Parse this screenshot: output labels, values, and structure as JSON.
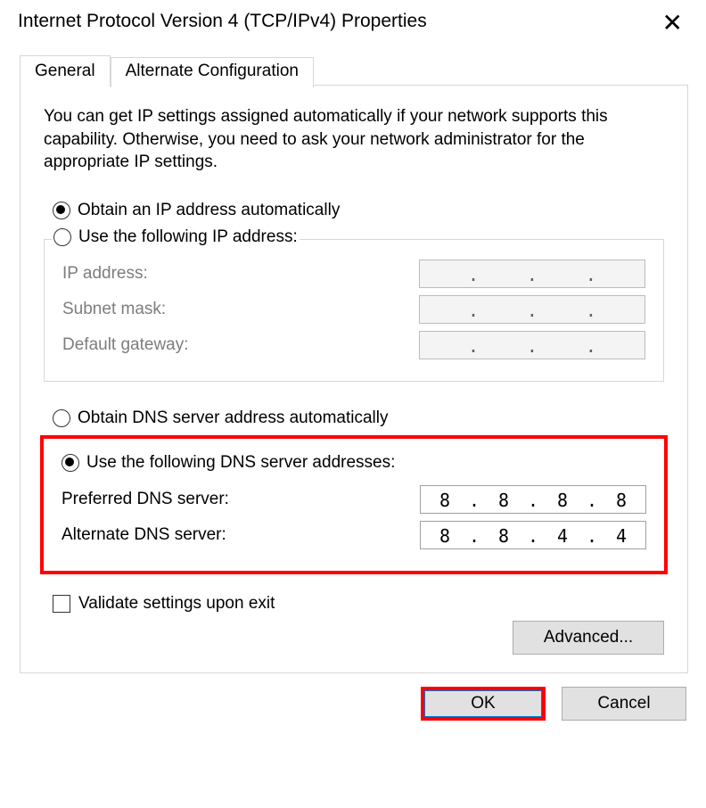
{
  "window": {
    "title": "Internet Protocol Version 4 (TCP/IPv4) Properties"
  },
  "tabs": {
    "general": "General",
    "alternate": "Alternate Configuration"
  },
  "description": "You can get IP settings assigned automatically if your network supports this capability. Otherwise, you need to ask your network administrator for the appropriate IP settings.",
  "ip_section": {
    "obtain_auto": "Obtain an IP address automatically",
    "use_following": "Use the following IP address:",
    "ip_address_label": "IP address:",
    "subnet_label": "Subnet mask:",
    "gateway_label": "Default gateway:"
  },
  "dns_section": {
    "obtain_auto": "Obtain DNS server address automatically",
    "use_following": "Use the following DNS server addresses:",
    "preferred_label": "Preferred DNS server:",
    "alternate_label": "Alternate DNS server:",
    "preferred": {
      "o1": "8",
      "o2": "8",
      "o3": "8",
      "o4": "8"
    },
    "alternate": {
      "o1": "8",
      "o2": "8",
      "o3": "4",
      "o4": "4"
    }
  },
  "validate_label": "Validate settings upon exit",
  "buttons": {
    "advanced": "Advanced...",
    "ok": "OK",
    "cancel": "Cancel"
  }
}
